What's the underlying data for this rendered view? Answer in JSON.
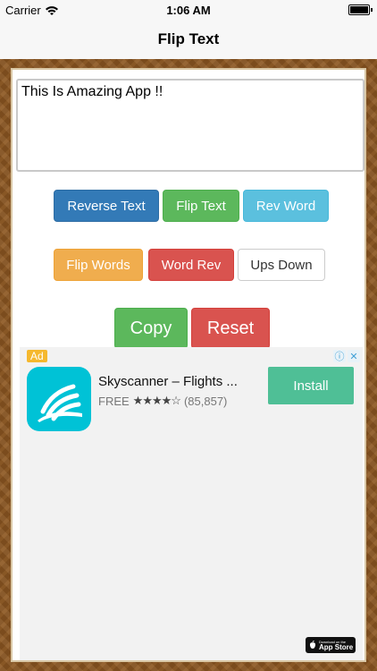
{
  "status_bar": {
    "carrier": "Carrier",
    "time": "1:06 AM",
    "wifi_icon": "wifi-icon",
    "battery_icon": "battery-icon",
    "battery_level": 1.0
  },
  "nav": {
    "title": "Flip Text"
  },
  "editor": {
    "value": "This Is Amazing App !!"
  },
  "buttons": {
    "reverse_text": "Reverse Text",
    "flip_text": "Flip Text",
    "rev_word": "Rev Word",
    "flip_words": "Flip Words",
    "word_rev": "Word Rev",
    "ups_down": "Ups Down",
    "copy": "Copy",
    "reset": "Reset"
  },
  "ad": {
    "badge": "Ad",
    "app_name": "Skyscanner – Flights ...",
    "price": "FREE",
    "rating_stars": "★★★★☆",
    "rating_count": "(85,857)",
    "install_label": "Install",
    "store_small": "Download on the",
    "store_name": "App Store",
    "icon": "skyscanner-icon",
    "icon_color": "#00c2d6"
  },
  "colors": {
    "primary": "#337ab7",
    "success": "#5cb85c",
    "info": "#5bc0de",
    "warning": "#f0ad4e",
    "danger": "#d9534f",
    "frame": "#8a5521"
  }
}
